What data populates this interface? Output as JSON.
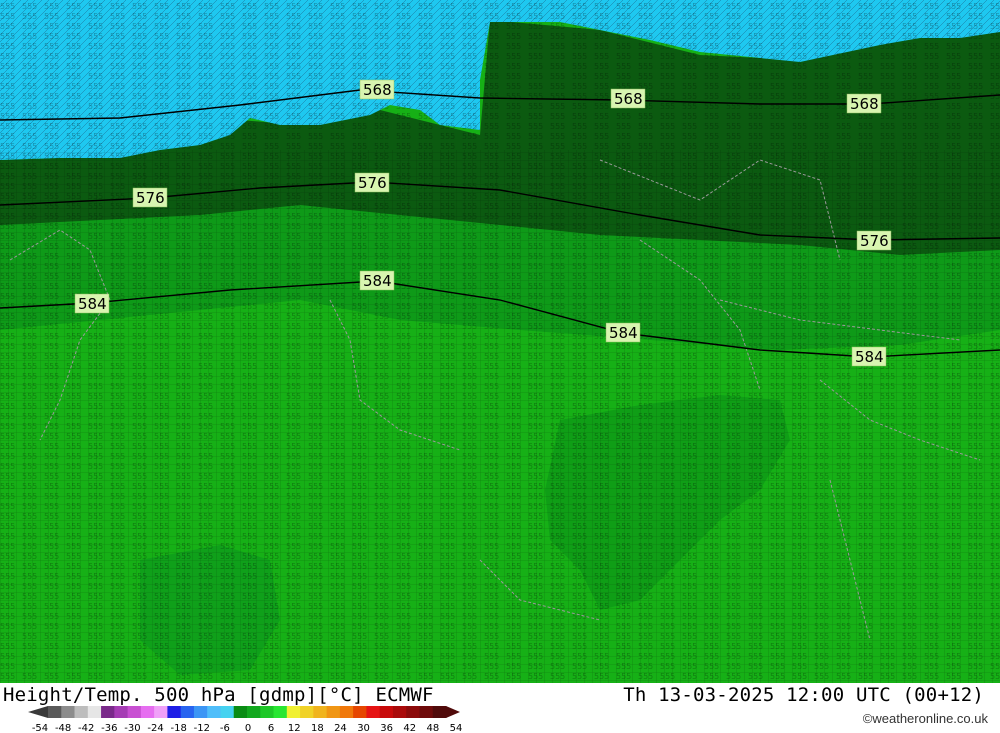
{
  "map": {
    "contour_unit": "gdmp",
    "contours": [
      {
        "label": "568",
        "value": 568
      },
      {
        "label": "576",
        "value": 576
      },
      {
        "label": "584",
        "value": 584
      }
    ],
    "labels": [
      {
        "text": "568"
      },
      {
        "text": "568"
      },
      {
        "text": "568"
      },
      {
        "text": "576"
      },
      {
        "text": "576"
      },
      {
        "text": "576"
      },
      {
        "text": "584"
      },
      {
        "text": "584"
      },
      {
        "text": "584"
      },
      {
        "text": "584"
      }
    ],
    "colors": {
      "cold": "#1ec8f0",
      "mid": "#0a8a18",
      "dark": "#0b5a10",
      "warm": "#16b016",
      "contour_line": "#000000",
      "border_line": "#9a9a9a"
    }
  },
  "footer": {
    "title": "Height/Temp. 500 hPa [gdmp][°C] ECMWF",
    "datetime": "Th 13-03-2025 12:00 UTC (00+12)",
    "credit": "©weatheronline.co.uk"
  },
  "legend": {
    "ticks": [
      "-54",
      "-48",
      "-42",
      "-36",
      "-30",
      "-24",
      "-18",
      "-12",
      "-6",
      "0",
      "6",
      "12",
      "18",
      "24",
      "30",
      "36",
      "42",
      "48",
      "54"
    ],
    "colors": [
      "#5a5a5a",
      "#8c8c8c",
      "#bdbdbd",
      "#e6e6e6",
      "#7a2a8a",
      "#a53cb4",
      "#c850d2",
      "#e66ef0",
      "#f0a0f8",
      "#1e1ee6",
      "#2864f0",
      "#3c96f5",
      "#50befa",
      "#46d2f0",
      "#0a8c14",
      "#12a81e",
      "#1ec828",
      "#28e632",
      "#f0f032",
      "#f0d228",
      "#f0b41e",
      "#f09614",
      "#f0780a",
      "#e64600",
      "#e61414",
      "#c80a0a",
      "#aa0a0a",
      "#8c0a0a",
      "#6e0a0a",
      "#500a0a"
    ]
  }
}
